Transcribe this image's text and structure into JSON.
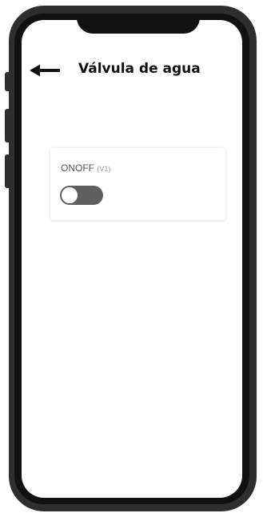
{
  "header": {
    "title": "Válvula de agua",
    "back_icon": "arrow-left-icon"
  },
  "widget": {
    "label": "ONOFF",
    "pin": "(V1)",
    "toggle_state": "off"
  },
  "colors": {
    "frame": "#2e2e2e",
    "bezel": "#111111",
    "toggle_track": "#5f5f5f",
    "toggle_knob": "#ffffff"
  }
}
